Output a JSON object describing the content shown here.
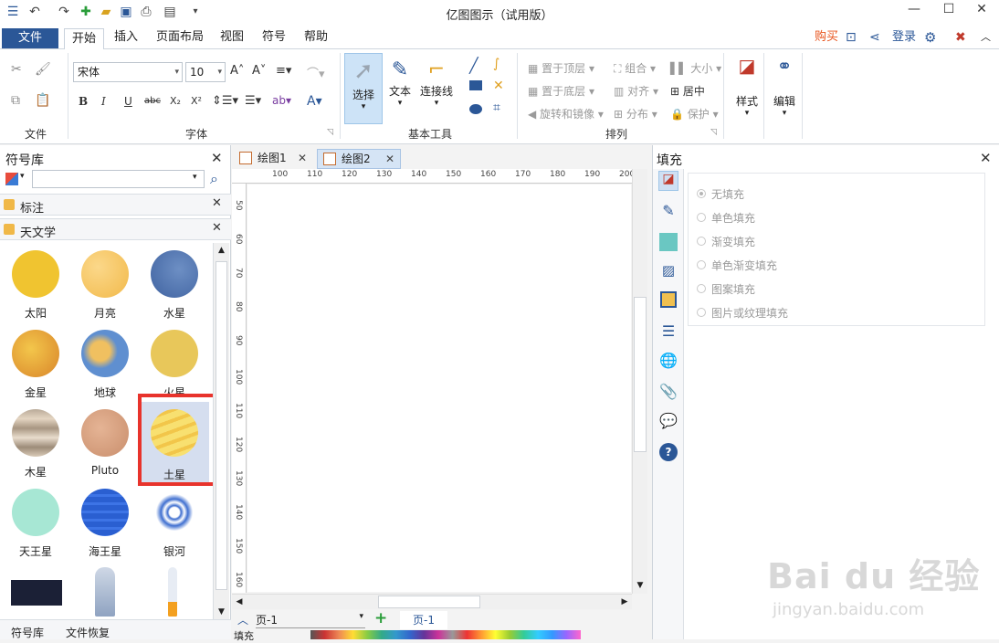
{
  "window": {
    "title": "亿图图示（试用版）",
    "min_icon": "minimize-icon",
    "max_icon": "maximize-icon",
    "close_icon": "close-icon"
  },
  "menubar": {
    "file": "文件",
    "tabs": [
      "开始",
      "插入",
      "页面布局",
      "视图",
      "符号",
      "帮助"
    ],
    "active_tab": "开始",
    "buy": "购买",
    "login": "登录"
  },
  "ribbon": {
    "groups": {
      "file": "文件",
      "font": "字体",
      "basic_tools": "基本工具",
      "arrange": "排列"
    },
    "font_name": "宋体",
    "font_size": "10",
    "select": "选择",
    "text": "文本",
    "connector": "连接线",
    "arrange_items": {
      "bring_front": "置于顶层",
      "group": "组合",
      "size": "大小",
      "send_back": "置于底层",
      "align": "对齐",
      "center": "居中",
      "rotate": "旋转和镜像",
      "distribute": "分布",
      "protect": "保护"
    },
    "style": "样式",
    "edit": "编辑"
  },
  "left_panel": {
    "title": "符号库",
    "search_placeholder": "",
    "libraries": [
      "标注",
      "天文学"
    ],
    "symbols": [
      {
        "name": "太阳"
      },
      {
        "name": "月亮"
      },
      {
        "name": "水星"
      },
      {
        "name": "金星"
      },
      {
        "name": "地球"
      },
      {
        "name": "火星"
      },
      {
        "name": "木星"
      },
      {
        "name": "Pluto"
      },
      {
        "name": "土星"
      },
      {
        "name": "天王星"
      },
      {
        "name": "海王星"
      },
      {
        "name": "银河"
      }
    ],
    "bottom_tabs": [
      "符号库",
      "文件恢复"
    ]
  },
  "canvas": {
    "tabs": [
      "绘图1",
      "绘图2"
    ],
    "active_tab": "绘图2",
    "ruler_top": [
      "100",
      "110",
      "120",
      "130",
      "140",
      "150",
      "160",
      "170",
      "180",
      "190",
      "200"
    ],
    "ruler_left": [
      "50",
      "60",
      "70",
      "80",
      "90",
      "100",
      "110",
      "120",
      "130",
      "140",
      "150",
      "160"
    ],
    "page_select": "页-1",
    "page_tab": "页-1",
    "fill_label": "填充"
  },
  "right_panel": {
    "title": "填充",
    "options": [
      "无填充",
      "单色填充",
      "渐变填充",
      "单色渐变填充",
      "图案填充",
      "图片或纹理填充"
    ],
    "selected": "无填充"
  },
  "watermark": {
    "brand": "Bai du 经验",
    "url": "jingyan.baidu.com"
  },
  "colors": {
    "accent": "#2b5797",
    "highlight_box": "#e8332c",
    "buy": "#e8541d"
  }
}
